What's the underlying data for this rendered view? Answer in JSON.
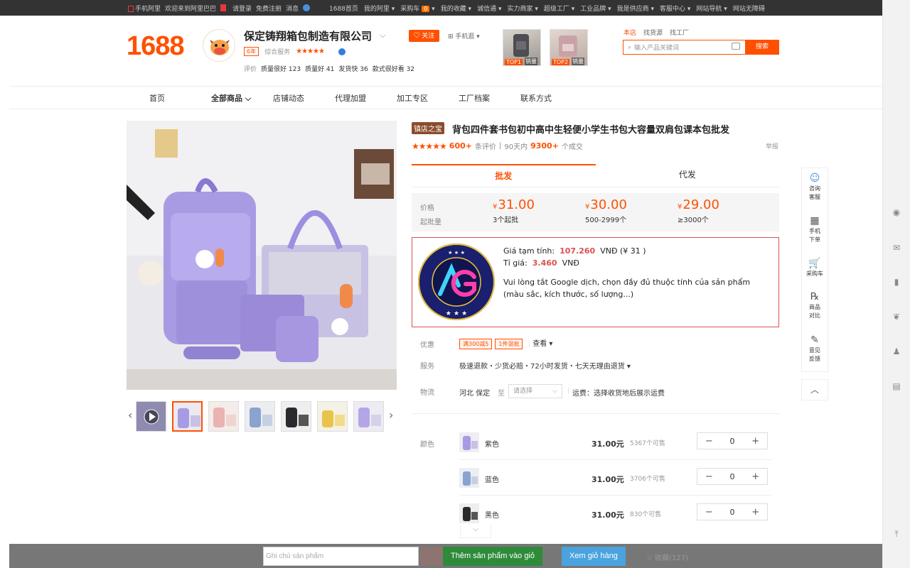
{
  "topbar": {
    "left": [
      "手机阿里",
      "欢迎来到阿里巴巴",
      "请登录",
      "免费注册",
      "消息"
    ],
    "right": [
      "1688首页",
      "我的阿里 ▾",
      "采购车",
      "0",
      "▾",
      "我的收藏 ▾",
      "诚信通 ▾",
      "实力商家 ▾",
      "超级工厂 ▾",
      "工业品牌 ▾",
      "我是供应商 ▾",
      "客服中心 ▾",
      "网站导航 ▾",
      "网站无障碍"
    ]
  },
  "header": {
    "logo": "1688",
    "shop_name": "保定铸翔箱包制造有限公司",
    "follow": "♡ 关注",
    "mobile": "手机逛 ▾",
    "years": "6年",
    "service_label": "综合服务",
    "service_stars": "★★★★★",
    "ratings_label": "评价",
    "ratings": [
      "质量很好 123",
      "质量好 41",
      "发货快 36",
      "款式很好看 32"
    ],
    "top_thumbs": [
      {
        "tag": "TOP1",
        "sub": "销量"
      },
      {
        "tag": "TOP2",
        "sub": "销量"
      }
    ],
    "search_tabs": [
      "本店",
      "找货源",
      "找工厂"
    ],
    "search_placeholder": "输入产品关键词",
    "search_button": "搜索"
  },
  "nav": [
    "首页",
    "全部商品",
    "店铺动态",
    "代理加盟",
    "加工专区",
    "工厂档案",
    "联系方式"
  ],
  "product": {
    "badge": "镇店之宝",
    "title": "背包四件套书包初中高中生轻便小学生书包大容量双肩包课本包批发",
    "stars": "★★★★★",
    "reviews_count": "600+",
    "reviews_label": "条评价",
    "sep": "|",
    "days_label": "90天内",
    "deals_count": "9300+",
    "deals_label": "个成交",
    "report": "举报",
    "tabs": [
      "批发",
      "代发"
    ],
    "price_label": "价格",
    "moq_label": "起批量",
    "currency": "¥",
    "tiers": [
      {
        "price": "31.00",
        "qty": "3个起批"
      },
      {
        "price": "30.00",
        "qty": "500-2999个"
      },
      {
        "price": "29.00",
        "qty": "≥3000个"
      }
    ]
  },
  "extension": {
    "logo_text": "VẬN CHUYỂN TRUNG VIỆT",
    "logo_sub": "LOGISTIC",
    "logo_mark": "AG",
    "temp_price_label": "Giá tạm tính:",
    "temp_price": "107.260",
    "temp_price_suffix": "VNĐ (¥ 31 )",
    "rate_label": "Tỉ giá:",
    "rate": "3.460",
    "rate_suffix": "VNĐ",
    "note": "Vui lòng tắt Google dịch, chọn đầy đủ thuộc tính của sản phẩm (màu sắc, kích thước, số lượng...)"
  },
  "info": {
    "promo_label": "优惠",
    "promos": [
      "满300减5",
      "1件混批"
    ],
    "promo_more": "查看 ▾",
    "service_label": "服务",
    "service_text": "极速退款・少货必赔・72小时发货・七天无理由退货 ▾",
    "logistics_label": "物流",
    "origin": "河北 保定",
    "to": "至",
    "select_placeholder": "请选择",
    "freight": "运费：选择收货地后展示运费"
  },
  "skus": {
    "label": "颜色",
    "items": [
      {
        "name": "紫色",
        "price": "31.00元",
        "stock": "5367个可售",
        "qty": "0"
      },
      {
        "name": "蓝色",
        "price": "31.00元",
        "stock": "3706个可售",
        "qty": "0"
      },
      {
        "name": "黑色",
        "price": "31.00元",
        "stock": "830个可售",
        "qty": "0"
      }
    ]
  },
  "sidebar": [
    {
      "icon": "☺",
      "label": "咨询\n客服"
    },
    {
      "icon": "▦",
      "label": "手机\n下单"
    },
    {
      "icon": "🛒",
      "label": "采购车"
    },
    {
      "icon": "℞",
      "label": "商品\n对比"
    },
    {
      "icon": "✎",
      "label": "意见\n反馈"
    }
  ],
  "bottom": {
    "note_placeholder": "Ghi chú sản phẩm",
    "add_to_cart": "Thêm sản phẩm vào giỏ",
    "view_cart": "Xem giỏ hàng",
    "favorites": "☆ 收藏(127)"
  },
  "colors": {
    "accent": "#ff5000",
    "ext_border": "#d9534f",
    "cart_green": "#2e8b3a",
    "view_blue": "#4aa3df"
  }
}
